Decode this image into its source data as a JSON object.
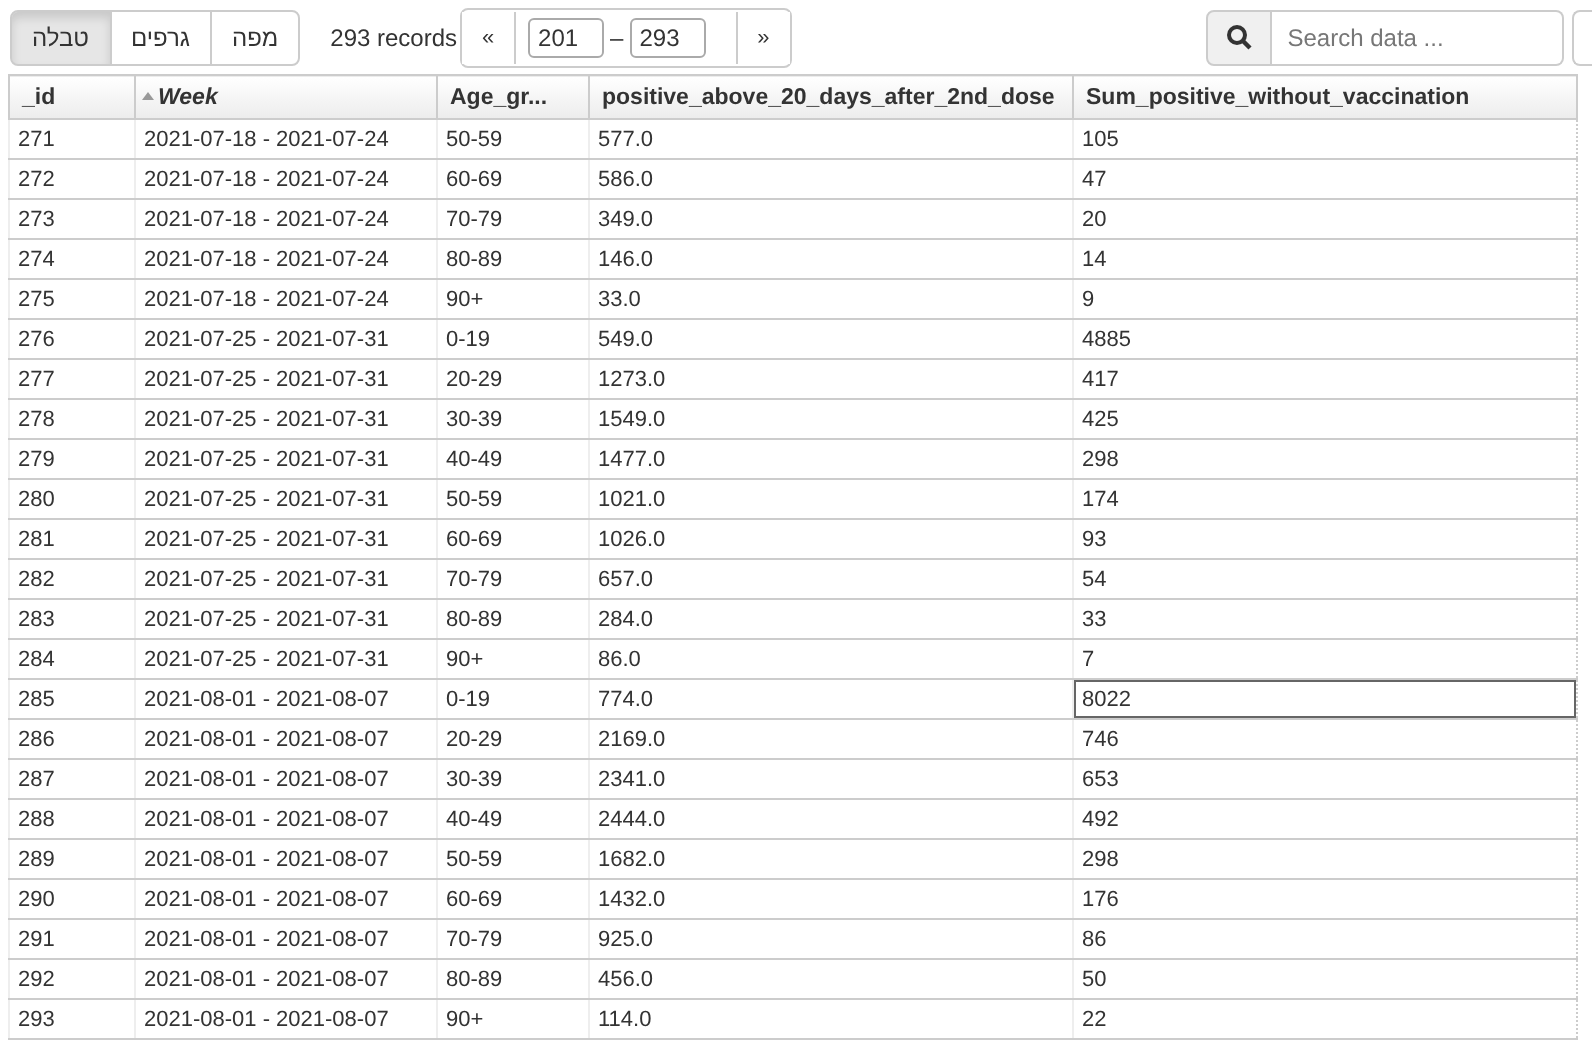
{
  "views": [
    {
      "label": "מפה",
      "selected": false
    },
    {
      "label": "גרפים",
      "selected": false
    },
    {
      "label": "טבלה",
      "selected": true
    }
  ],
  "record_count": "293 records",
  "pager": {
    "prev": "«",
    "from": "201",
    "separator": "–",
    "to": "293",
    "next": "»"
  },
  "search": {
    "placeholder": "Search data ..."
  },
  "table": {
    "columns": [
      {
        "label": "_id",
        "sorted": false
      },
      {
        "label": "Week",
        "sorted": true
      },
      {
        "label": "Age_gr...",
        "sorted": false
      },
      {
        "label": "positive_above_20_days_after_2nd_dose",
        "sorted": false
      },
      {
        "label": "Sum_positive_without_vaccination",
        "sorted": false
      }
    ],
    "rows": [
      {
        "cells": [
          "271",
          "2021-07-18 - 2021-07-24",
          "50-59",
          "577.0",
          "105"
        ],
        "focused": false
      },
      {
        "cells": [
          "272",
          "2021-07-18 - 2021-07-24",
          "60-69",
          "586.0",
          "47"
        ],
        "focused": false
      },
      {
        "cells": [
          "273",
          "2021-07-18 - 2021-07-24",
          "70-79",
          "349.0",
          "20"
        ],
        "focused": false
      },
      {
        "cells": [
          "274",
          "2021-07-18 - 2021-07-24",
          "80-89",
          "146.0",
          "14"
        ],
        "focused": false
      },
      {
        "cells": [
          "275",
          "2021-07-18 - 2021-07-24",
          "90+",
          "33.0",
          "9"
        ],
        "focused": false
      },
      {
        "cells": [
          "276",
          "2021-07-25 - 2021-07-31",
          "0-19",
          "549.0",
          "4885"
        ],
        "focused": false
      },
      {
        "cells": [
          "277",
          "2021-07-25 - 2021-07-31",
          "20-29",
          "1273.0",
          "417"
        ],
        "focused": false
      },
      {
        "cells": [
          "278",
          "2021-07-25 - 2021-07-31",
          "30-39",
          "1549.0",
          "425"
        ],
        "focused": false
      },
      {
        "cells": [
          "279",
          "2021-07-25 - 2021-07-31",
          "40-49",
          "1477.0",
          "298"
        ],
        "focused": false
      },
      {
        "cells": [
          "280",
          "2021-07-25 - 2021-07-31",
          "50-59",
          "1021.0",
          "174"
        ],
        "focused": false
      },
      {
        "cells": [
          "281",
          "2021-07-25 - 2021-07-31",
          "60-69",
          "1026.0",
          "93"
        ],
        "focused": false
      },
      {
        "cells": [
          "282",
          "2021-07-25 - 2021-07-31",
          "70-79",
          "657.0",
          "54"
        ],
        "focused": false
      },
      {
        "cells": [
          "283",
          "2021-07-25 - 2021-07-31",
          "80-89",
          "284.0",
          "33"
        ],
        "focused": false
      },
      {
        "cells": [
          "284",
          "2021-07-25 - 2021-07-31",
          "90+",
          "86.0",
          "7"
        ],
        "focused": false
      },
      {
        "cells": [
          "285",
          "2021-08-01 - 2021-08-07",
          "0-19",
          "774.0",
          "8022"
        ],
        "focused": true
      },
      {
        "cells": [
          "286",
          "2021-08-01 - 2021-08-07",
          "20-29",
          "2169.0",
          "746"
        ],
        "focused": false
      },
      {
        "cells": [
          "287",
          "2021-08-01 - 2021-08-07",
          "30-39",
          "2341.0",
          "653"
        ],
        "focused": false
      },
      {
        "cells": [
          "288",
          "2021-08-01 - 2021-08-07",
          "40-49",
          "2444.0",
          "492"
        ],
        "focused": false
      },
      {
        "cells": [
          "289",
          "2021-08-01 - 2021-08-07",
          "50-59",
          "1682.0",
          "298"
        ],
        "focused": false
      },
      {
        "cells": [
          "290",
          "2021-08-01 - 2021-08-07",
          "60-69",
          "1432.0",
          "176"
        ],
        "focused": false
      },
      {
        "cells": [
          "291",
          "2021-08-01 - 2021-08-07",
          "70-79",
          "925.0",
          "86"
        ],
        "focused": false
      },
      {
        "cells": [
          "292",
          "2021-08-01 - 2021-08-07",
          "80-89",
          "456.0",
          "50"
        ],
        "focused": false
      },
      {
        "cells": [
          "293",
          "2021-08-01 - 2021-08-07",
          "90+",
          "114.0",
          "22"
        ],
        "focused": false
      }
    ]
  }
}
